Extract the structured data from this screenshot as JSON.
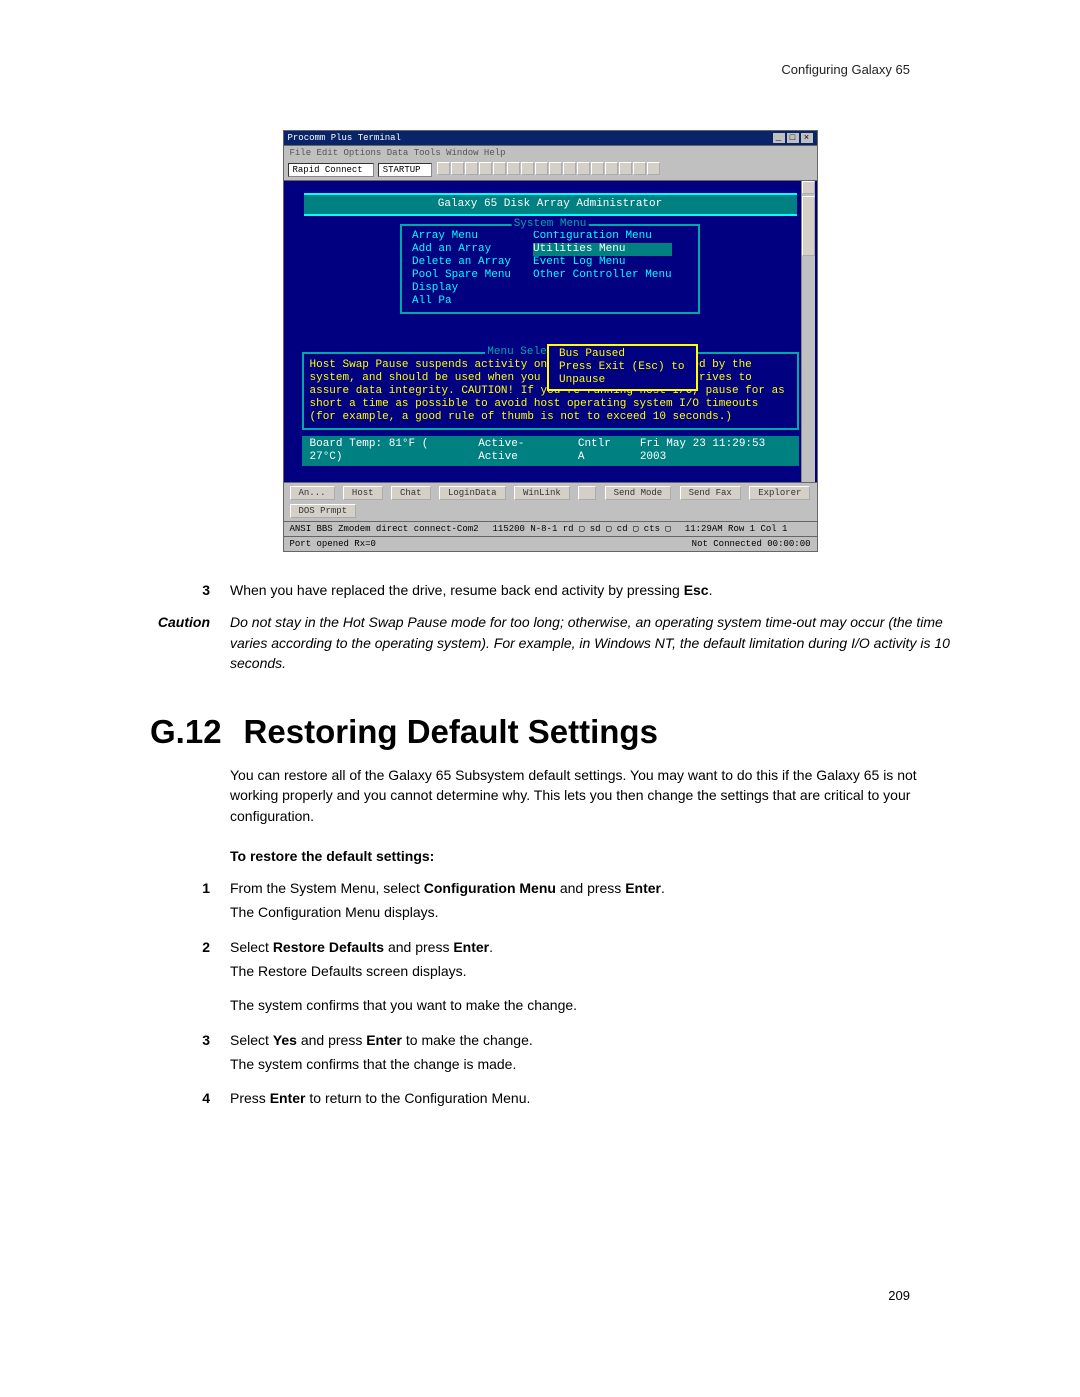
{
  "header_right": "Configuring Galaxy 65",
  "terminal": {
    "title": "Procomm Plus Terminal",
    "menubar": "File  Edit  Options  Data  Tools  Window  Help",
    "combo1": "Rapid Connect",
    "combo2": "STARTUP",
    "header_bar": "Galaxy 65 Disk Array Administrator",
    "system_menu_title": "System Menu",
    "left_items": [
      "Array Menu",
      "Add an Array",
      "Delete an Array",
      "Pool Spare Menu",
      "Display",
      "All Pa"
    ],
    "right_items": [
      "Configuration Menu",
      "Utilities Menu",
      "Event Log Menu",
      "Other Controller Menu"
    ],
    "bus_line1": "Bus Paused",
    "bus_line2": "Press Exit (Esc) to Unpause",
    "help_title": "Menu Selection Help",
    "help_text": "Host Swap Pause suspends activity on all drive channels used by the system, and should be used when you remove or replace any drives to assure data integrity. CAUTION! If you're running host I/O, pause for as short a time as possible to avoid host operating system I/O timeouts (for example, a good rule of thumb is not to exceed 10 seconds.)",
    "status_temp": "Board Temp:  81°F ( 27°C)",
    "status_mode": "Active-Active",
    "status_ctrl": "Cntlr A",
    "status_time": "Fri May 23 11:29:53 2003",
    "bottom_buttons": [
      "An...",
      "Host",
      "Chat",
      "LoginData",
      "WinLink",
      "",
      "Send Mode",
      "Send Fax",
      "Explorer",
      "DOS Prmpt"
    ],
    "status2_left": "ANSI BBS    Zmodem    direct connect-Com2",
    "status2_mid": "115200   N-8-1   rd ▢ sd ▢ cd ▢ cts ▢",
    "status2_right": "11:29AM      Row 1   Col 1",
    "status3_left": "Port opened  Rx=0",
    "status3_right": "Not Connected    00:00:00"
  },
  "step3": {
    "num": "3",
    "text_before": "When you have replaced the drive, resume back end activity by pressing ",
    "key": "Esc",
    "text_after": "."
  },
  "caution": {
    "label": "Caution",
    "text": "Do not stay in the Hot Swap Pause mode for too long; otherwise, an operating system time-out may occur (the time varies according to the operating system). For example, in Windows NT, the default limitation during I/O activity is 10 seconds."
  },
  "section": {
    "num": "G.12",
    "title": "Restoring Default Settings"
  },
  "intro": "You can restore all of the Galaxy 65 Subsystem default settings. You may want to do this if the Galaxy 65 is not working properly and you cannot determine why. This lets you then change the settings that are critical to your configuration.",
  "subhead": "To restore the default settings:",
  "steps": [
    {
      "n": "1",
      "parts": [
        "From the System Menu, select ",
        "<b>Configuration Menu</b>",
        " and press ",
        "<b>Enter</b>",
        "."
      ],
      "sub": "The Configuration Menu displays."
    },
    {
      "n": "2",
      "parts": [
        "Select ",
        "<b>Restore Defaults</b>",
        " and press ",
        "<b>Enter</b>",
        "."
      ],
      "sub": "The Restore Defaults screen displays.",
      "sub2": "The system confirms that you want to make the change."
    },
    {
      "n": "3",
      "parts": [
        "Select ",
        "<b>Yes</b>",
        " and press ",
        "<b>Enter</b>",
        " to make the change."
      ],
      "sub": "The system confirms that the change is made."
    },
    {
      "n": "4",
      "parts": [
        "Press ",
        "<b>Enter</b>",
        " to return to the Configuration Menu."
      ]
    }
  ],
  "page_number": "209"
}
